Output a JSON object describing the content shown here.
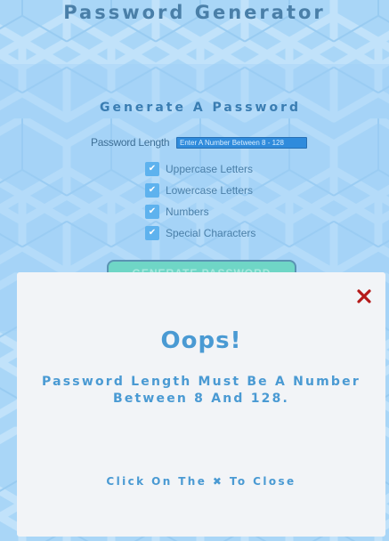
{
  "app": {
    "title": "Password Generator"
  },
  "form": {
    "title": "Generate A Password",
    "length_label": "Password Length",
    "length_placeholder": "Enter A Number Between 8 - 128",
    "length_value": "",
    "options": [
      {
        "label": "Uppercase Letters",
        "checked": true
      },
      {
        "label": "Lowercase Letters",
        "checked": true
      },
      {
        "label": "Numbers",
        "checked": true
      },
      {
        "label": "Special Characters",
        "checked": true
      }
    ],
    "generate_label": "GENERATE PASSWORD"
  },
  "modal": {
    "heading": "Oops!",
    "message": "Password Length Must Be A Number Between 8 And 128.",
    "hint_before": "Click On The",
    "hint_icon": "✖",
    "hint_after": "To Close",
    "close_icon": "close-icon"
  },
  "colors": {
    "background": "#a9d6f7",
    "accent": "#4a9ad3",
    "close": "#b51a1a",
    "button": "#6fd6c6"
  }
}
